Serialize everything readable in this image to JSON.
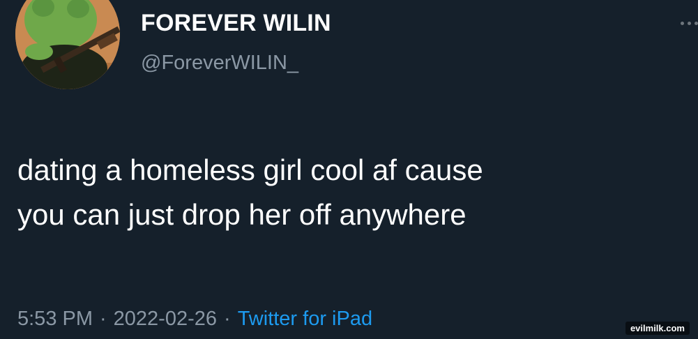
{
  "tweet": {
    "display_name": "FOREVER WILIN",
    "handle": "@ForeverWILIN_",
    "text_lines": [
      "dating a homeless girl cool af cause",
      "you can just drop her off anywhere"
    ],
    "time": "5:53 PM",
    "separator": "·",
    "date": "2022-02-26",
    "source": "Twitter for iPad",
    "more_icon": "more-dots-icon"
  },
  "watermark": "evilmilk.com",
  "colors": {
    "background": "#15202b",
    "text": "#ffffff",
    "secondary_text": "#8b98a5",
    "link": "#1d9bf0"
  }
}
